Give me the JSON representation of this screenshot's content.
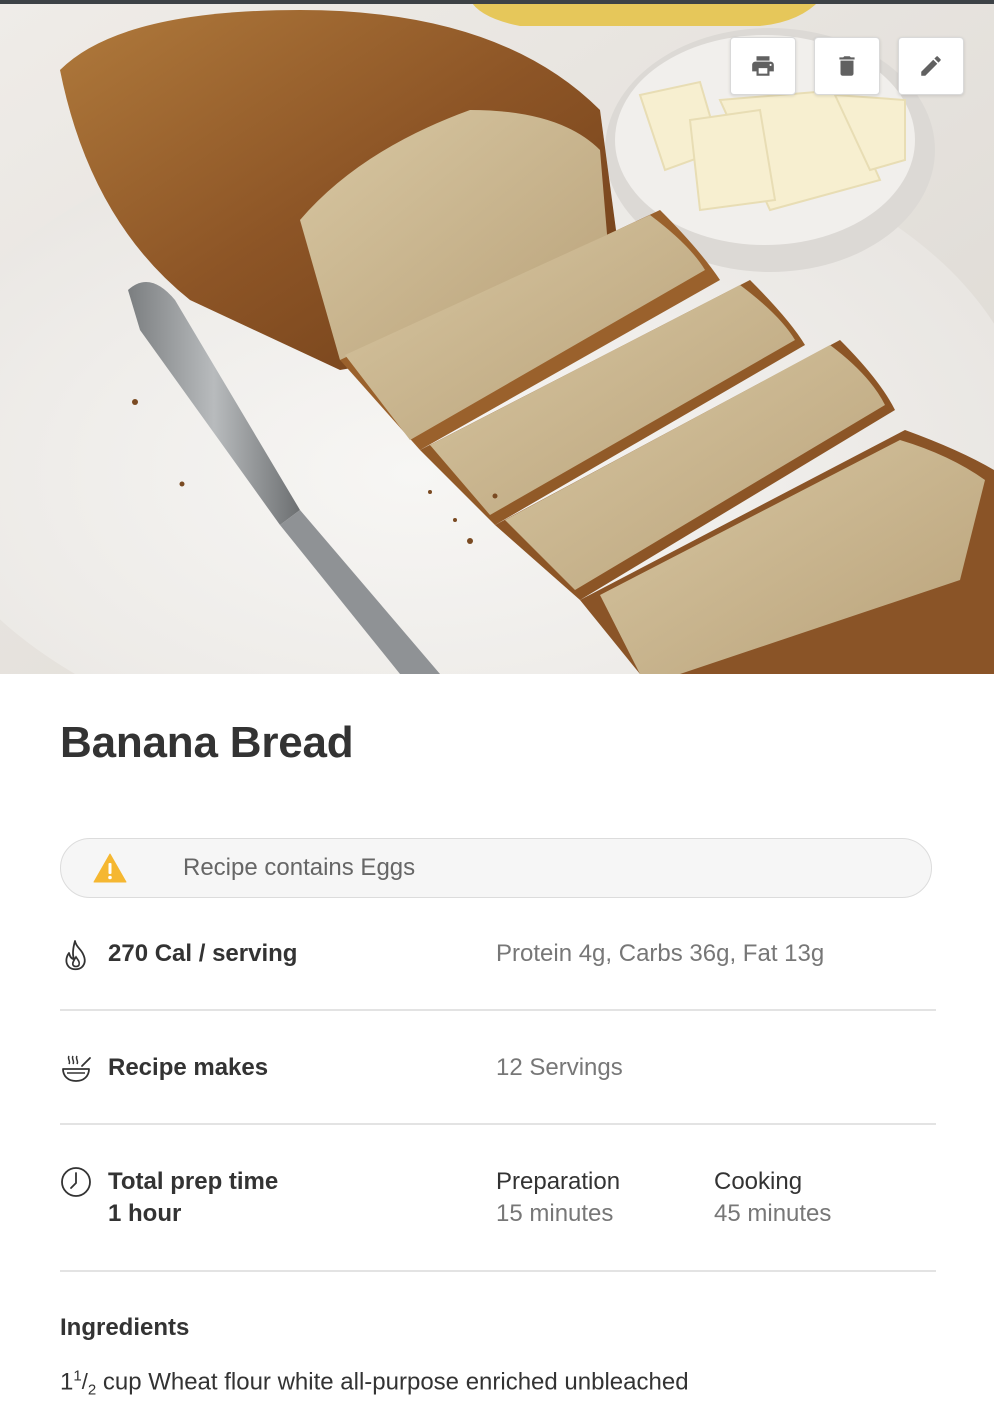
{
  "toolbar": {
    "print_icon": "print-icon",
    "delete_icon": "trash-icon",
    "edit_icon": "pencil-icon"
  },
  "recipe": {
    "title": "Banana Bread",
    "warning": "Recipe contains Eggs",
    "calories": "270 Cal / serving",
    "macros": "Protein 4g, Carbs 36g, Fat 13g",
    "makes_label": "Recipe makes",
    "makes_value": "12 Servings",
    "prep_label": "Total prep time",
    "prep_total": "1 hour",
    "preparation_label": "Preparation",
    "preparation_value": "15 minutes",
    "cooking_label": "Cooking",
    "cooking_value": "45 minutes"
  },
  "ingredients": {
    "title": "Ingredients",
    "items": [
      {
        "whole": "1",
        "num": "1",
        "den": "2",
        "text": "cup Wheat flour white all-purpose enriched unbleached"
      }
    ]
  },
  "colors": {
    "warning": "#f5b731",
    "text": "#333333",
    "muted": "#777777"
  }
}
